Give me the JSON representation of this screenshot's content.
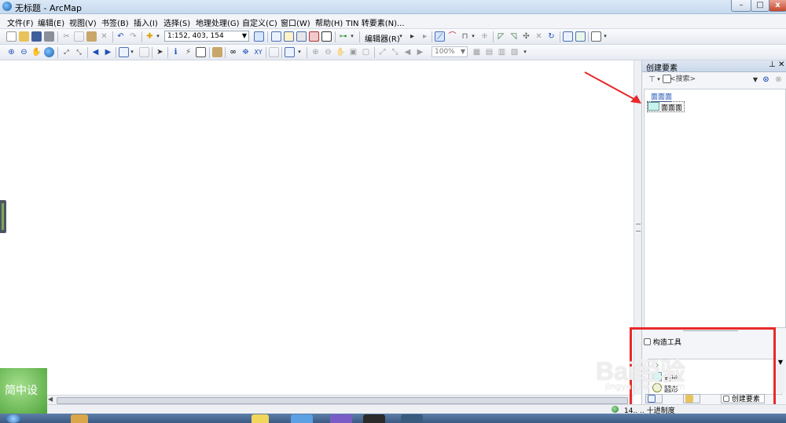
{
  "window": {
    "title": "无标题 - ArcMap"
  },
  "menu": [
    "文件(F)",
    "编辑(E)",
    "视图(V)",
    "书签(B)",
    "插入(I)",
    "选择(S)",
    "地理处理(G)",
    "自定义(C)",
    "窗口(W)",
    "帮助(H)",
    "TIN 转要素(N)..."
  ],
  "toolbar": {
    "scale_value": "1:152, 403, 154",
    "editor_label": "编辑器(R)",
    "zoom_value": "100%"
  },
  "panel": {
    "title": "创建要素",
    "search_placeholder": "<搜索>",
    "group_header": "面面面",
    "template_label": "面面面",
    "construct_title": "构造工具",
    "construct_tools": [
      "",
      "矩形",
      "圆形"
    ],
    "tabs": [
      "创建要素"
    ]
  },
  "status": {
    "coords": "14..  .. 十进制度"
  },
  "watermark": {
    "left_text": "简中设",
    "brand": "Bai经验",
    "url": "jingyan.baidu.com"
  },
  "colors": {
    "highlight_box": "#e82a2a",
    "arrow": "#e82a2a",
    "template_swatch": "#c7f3ef"
  }
}
